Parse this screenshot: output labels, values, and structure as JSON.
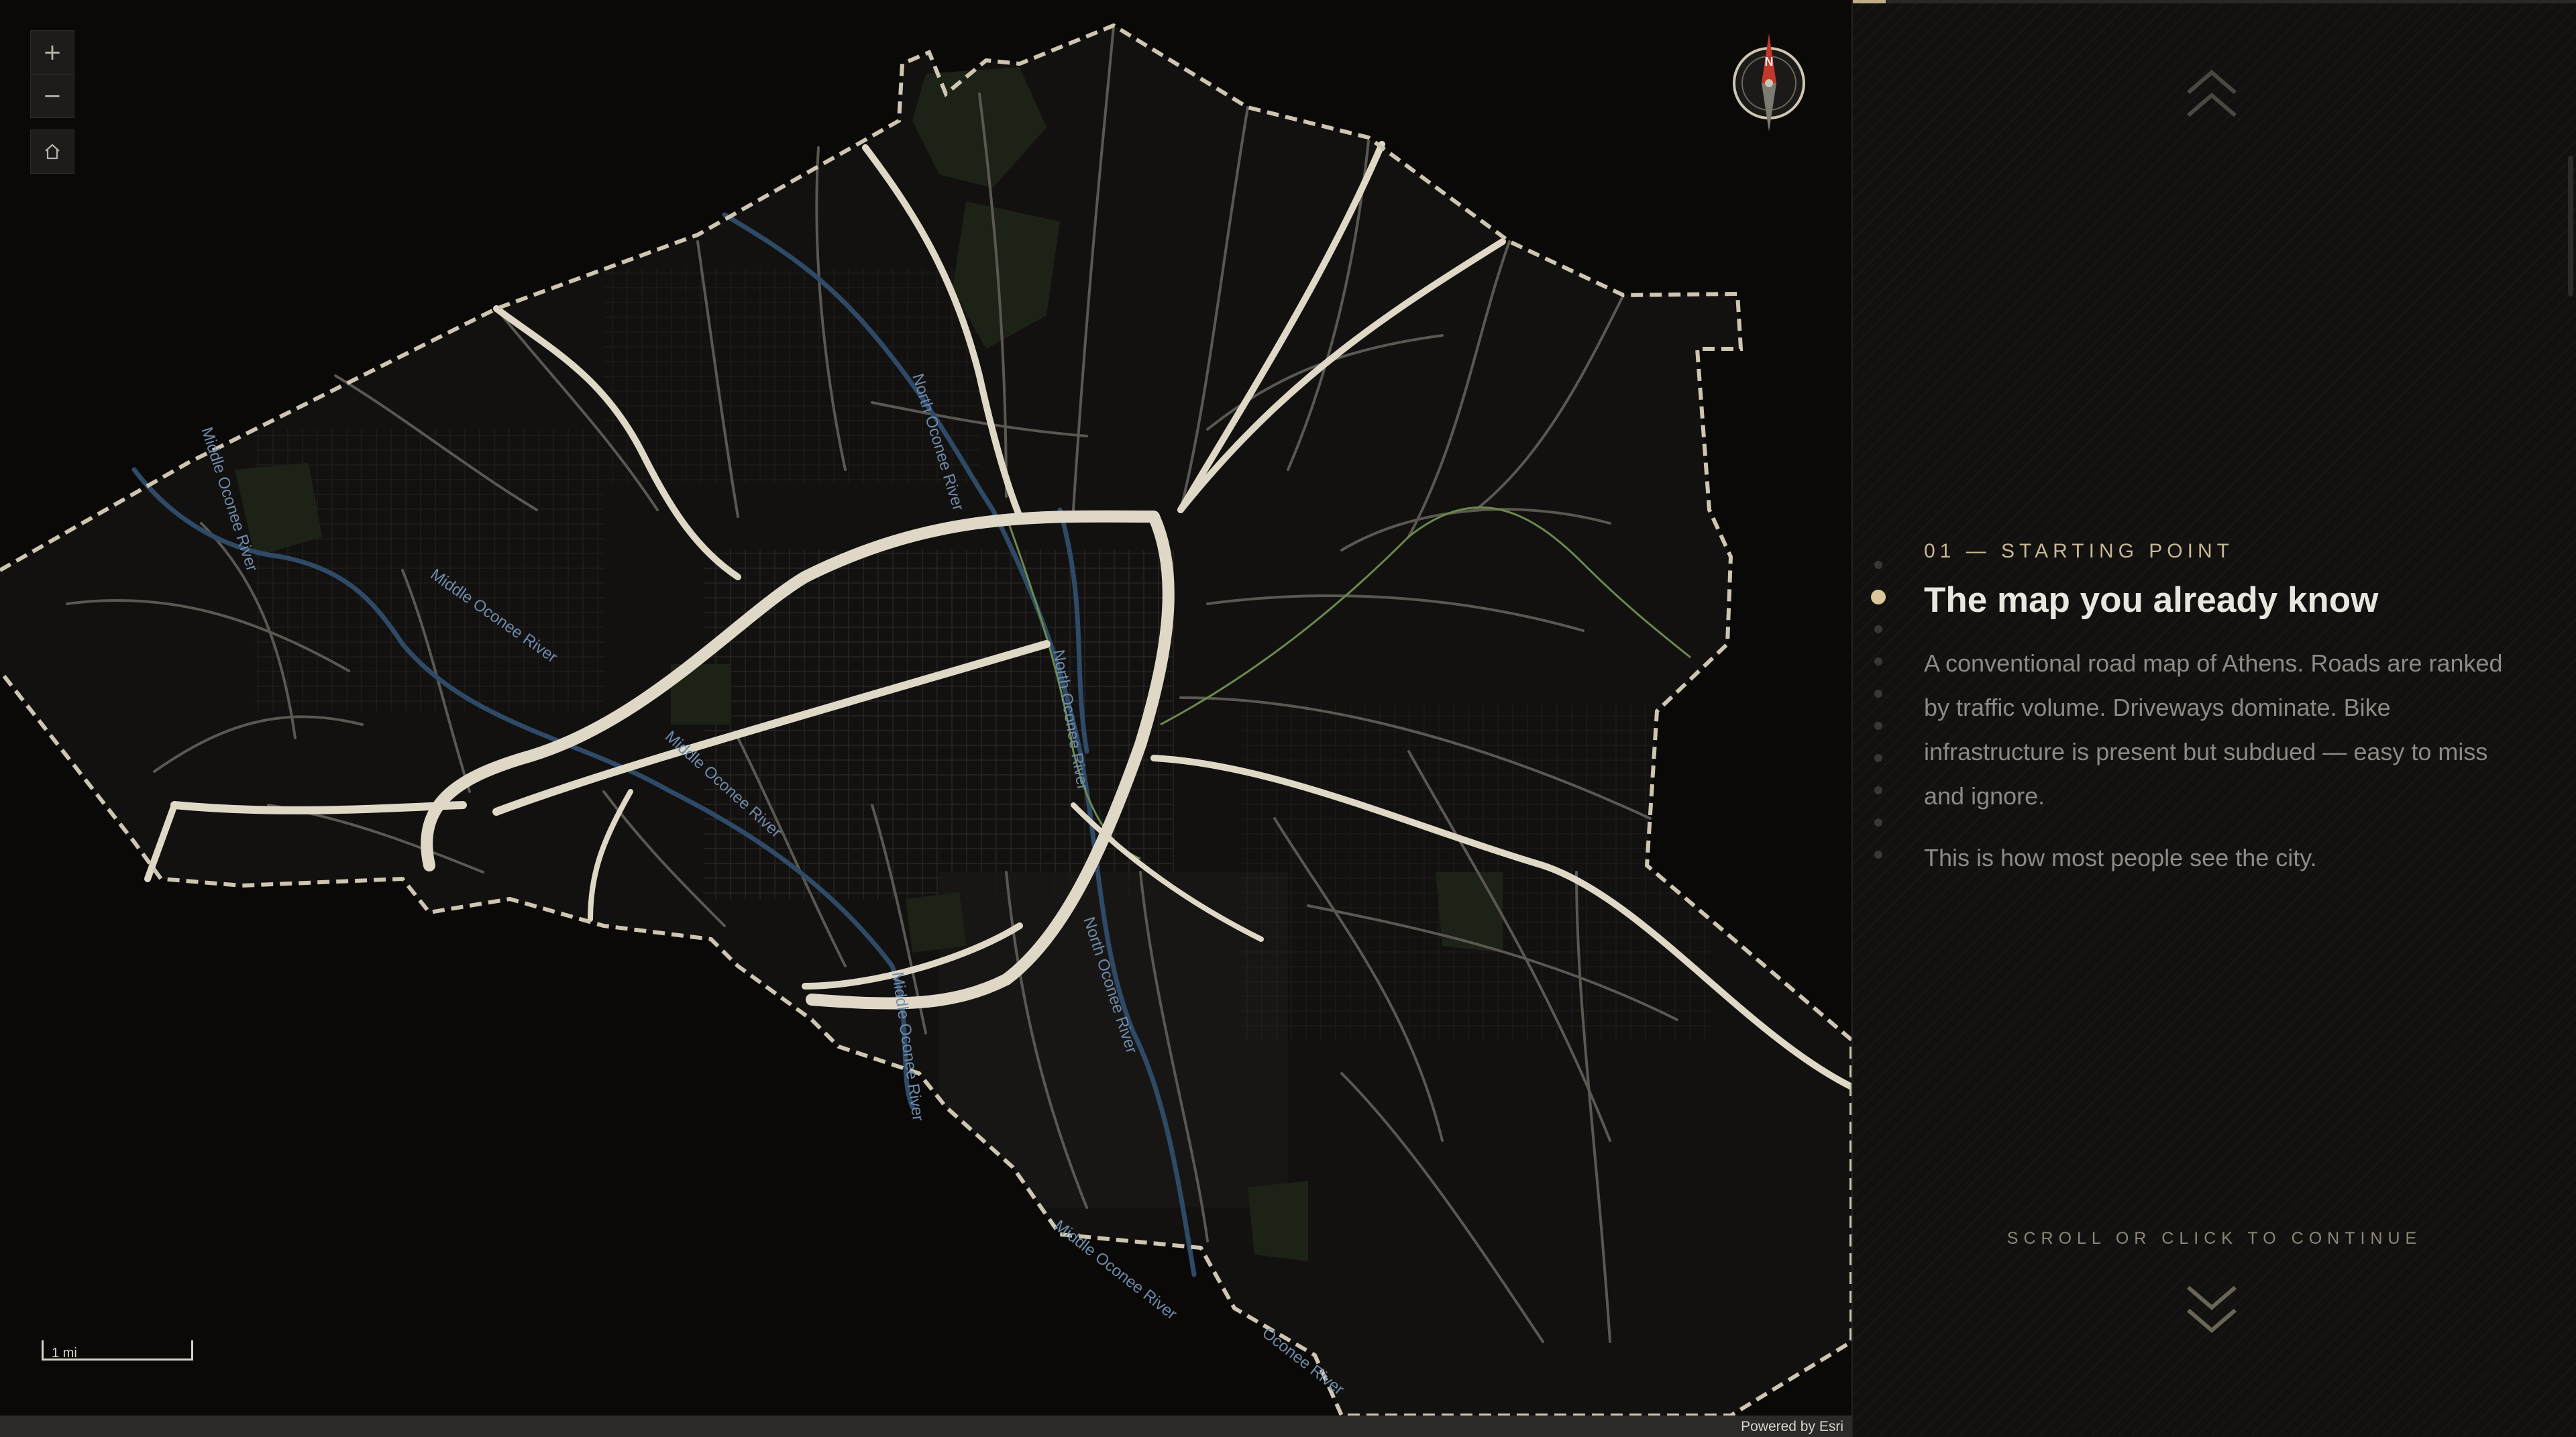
{
  "map": {
    "zoom_in_label": "+",
    "zoom_out_label": "−",
    "compass_letter": "N",
    "scale_label": "1 mi",
    "attribution": "Powered by Esri",
    "rivers": [
      {
        "id": "river-1",
        "label": "Middle Oconee River"
      },
      {
        "id": "river-2",
        "label": "Middle Oconee River"
      },
      {
        "id": "river-3",
        "label": "Middle Oconee River"
      },
      {
        "id": "river-4",
        "label": "North Oconee River"
      },
      {
        "id": "river-5",
        "label": "North Oconee River"
      },
      {
        "id": "river-6",
        "label": "North Oconee River"
      },
      {
        "id": "river-7",
        "label": "Middle Oconee River"
      },
      {
        "id": "river-8",
        "label": "Middle Oconee River"
      },
      {
        "id": "river-9",
        "label": "Oconee River"
      }
    ],
    "colors": {
      "boundary": "#cfc6b2",
      "major_road": "#e0d8c6",
      "minor_road": "#5b5751",
      "river": "#2e4a66",
      "river_label": "#6f8aaa",
      "park": "#1c2316",
      "bike_path": "#6b8a4c"
    }
  },
  "panel": {
    "progress": 0.045,
    "kicker": "01 — STARTING POINT",
    "title": "The map you already know",
    "paragraphs": [
      "A conventional road map of Athens. Roads are ranked by traffic volume. Driveways dominate. Bike infrastructure is present but subdued — easy to miss and ignore.",
      "This is how most people see the city."
    ],
    "continue_hint": "SCROLL OR CLICK TO CONTINUE",
    "steps": 10,
    "active_step": 2,
    "accent": "#d9c79b"
  }
}
